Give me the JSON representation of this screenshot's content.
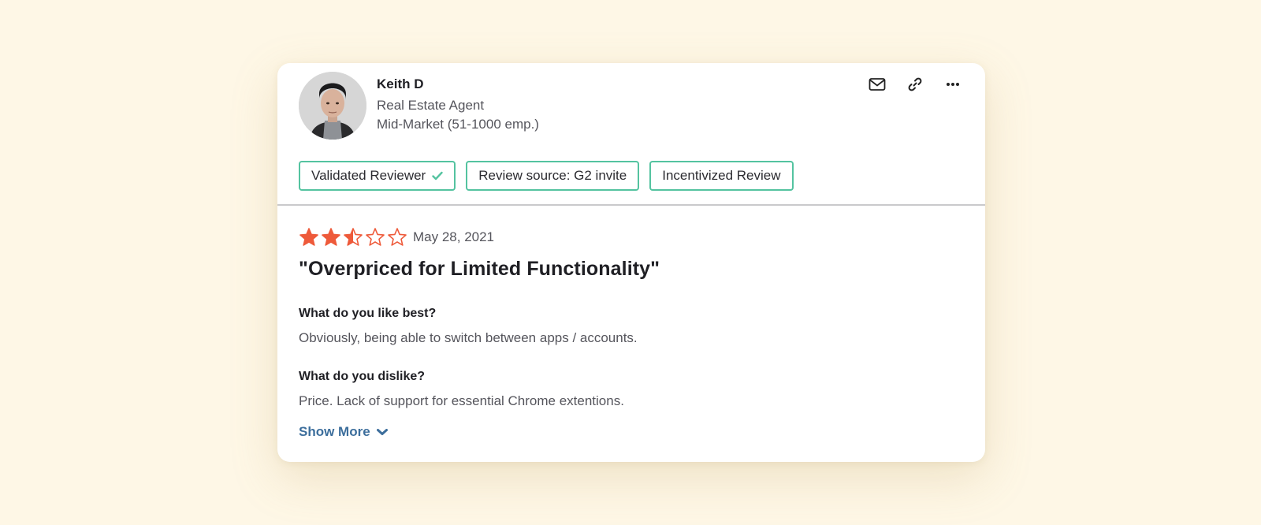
{
  "reviewer": {
    "name": "Keith D",
    "title": "Real Estate Agent",
    "segment": "Mid-Market (51-1000 emp.)"
  },
  "actions": {
    "email_icon": "envelope-icon",
    "link_icon": "link-icon",
    "more_icon": "more-horizontal-icon"
  },
  "badges": [
    {
      "label": "Validated Reviewer",
      "icon": "check-icon"
    },
    {
      "label": "Review source: G2 invite"
    },
    {
      "label": "Incentivized Review"
    }
  ],
  "review": {
    "rating": 2.5,
    "max_rating": 5,
    "date": "May 28, 2021",
    "title": "\"Overpriced for Limited Functionality\"",
    "questions": [
      {
        "label": "What do you like best?",
        "answer": "Obviously, being able to switch between apps / accounts."
      },
      {
        "label": "What do you dislike?",
        "answer": "Price. Lack of support for essential Chrome extentions."
      }
    ],
    "show_more": "Show More"
  },
  "colors": {
    "background": "#fef7e6",
    "star": "#ee5a3a",
    "badge_border": "#54c3a0",
    "link": "#3c6e9c"
  }
}
